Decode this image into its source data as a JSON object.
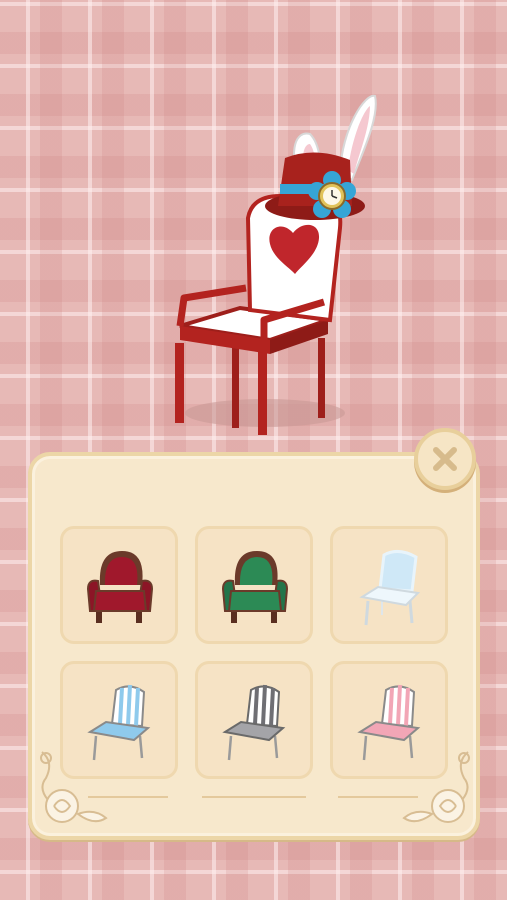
{
  "preview": {
    "item": "white-rabbit-heart-chair",
    "colors": {
      "frame": "#b3231f",
      "seat": "#ffffff",
      "heart": "#c0262c",
      "hat": "#a8221d",
      "flower": "#36a5d6"
    }
  },
  "panel": {
    "close_icon": "close-icon",
    "items": [
      {
        "name": "red-velvet-armchair",
        "colors": {
          "main": "#a0182c",
          "wood": "#6b3a2a"
        }
      },
      {
        "name": "green-velvet-armchair",
        "colors": {
          "main": "#2c8a55",
          "wood": "#6b3a2a"
        }
      },
      {
        "name": "crystal-glass-chair",
        "colors": {
          "main": "#cfe8f7",
          "frame": "#e8f4fb"
        }
      },
      {
        "name": "blue-striped-chair",
        "colors": {
          "main": "#8fcaec",
          "frame": "#ffffff"
        }
      },
      {
        "name": "gray-striped-chair",
        "colors": {
          "main": "#6f6f74",
          "frame": "#ffffff"
        }
      },
      {
        "name": "pink-striped-chair",
        "colors": {
          "main": "#f2a6b6",
          "frame": "#ffffff"
        }
      }
    ]
  }
}
